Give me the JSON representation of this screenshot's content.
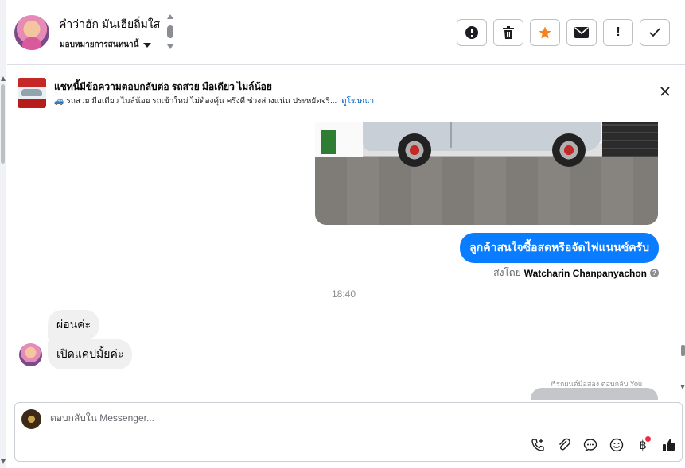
{
  "header": {
    "contact_name": "คำว่าฮัก มันเฮียถิ่มใส",
    "assign_label": "มอบหมายการสนทนานี้",
    "actions": [
      {
        "name": "report-button",
        "icon": "alert-circle-icon",
        "label": ""
      },
      {
        "name": "delete-button",
        "icon": "trash-icon",
        "label": ""
      },
      {
        "name": "star-button",
        "icon": "star-icon",
        "label": ""
      },
      {
        "name": "mark-unread-button",
        "icon": "envelope-icon",
        "label": ""
      },
      {
        "name": "follow-up-button",
        "icon": "exclamation-icon",
        "label": "!"
      },
      {
        "name": "mark-done-button",
        "icon": "checkmark-icon",
        "label": ""
      }
    ],
    "star_color": "#f5821f"
  },
  "banner": {
    "title": "แชทนี้มีข้อความตอบกลับต่อ รถสวย มือเดียว ไมล์น้อย",
    "text": "รถสวย มือเดียว ไมล์น้อย รถเข้าใหม่ ไม่ต้องคุ้น ครึ่งดี ช่วงล่างแน่น ประหยัดจริ...",
    "link": "ดูโฆษณา",
    "thumb_icon": "car-ad-thumbnail"
  },
  "conversation": {
    "outgoing_message": "ลูกค้าสนใจซื้อสดหรือจัดไฟแนนซ์ครับ",
    "sent_by_prefix": "ส่งโดย",
    "sent_by_name": "Watcharin Chanpanyachon",
    "timestamp": "18:40",
    "incoming": [
      {
        "text": "ผ่อนค่ะ"
      },
      {
        "text": "เปิดแคปมั้ยค่ะ"
      }
    ],
    "reply_note": "รถยนต์มือสอง ตอบกลับ You",
    "accent_color": "#0a7cff"
  },
  "composer": {
    "placeholder": "ตอบกลับใน Messenger...",
    "tools": [
      "call-add-icon",
      "attachment-icon",
      "saved-reply-icon",
      "emoji-icon",
      "baht-payment-icon",
      "thumbs-up-icon"
    ],
    "baht_symbol": "฿"
  }
}
